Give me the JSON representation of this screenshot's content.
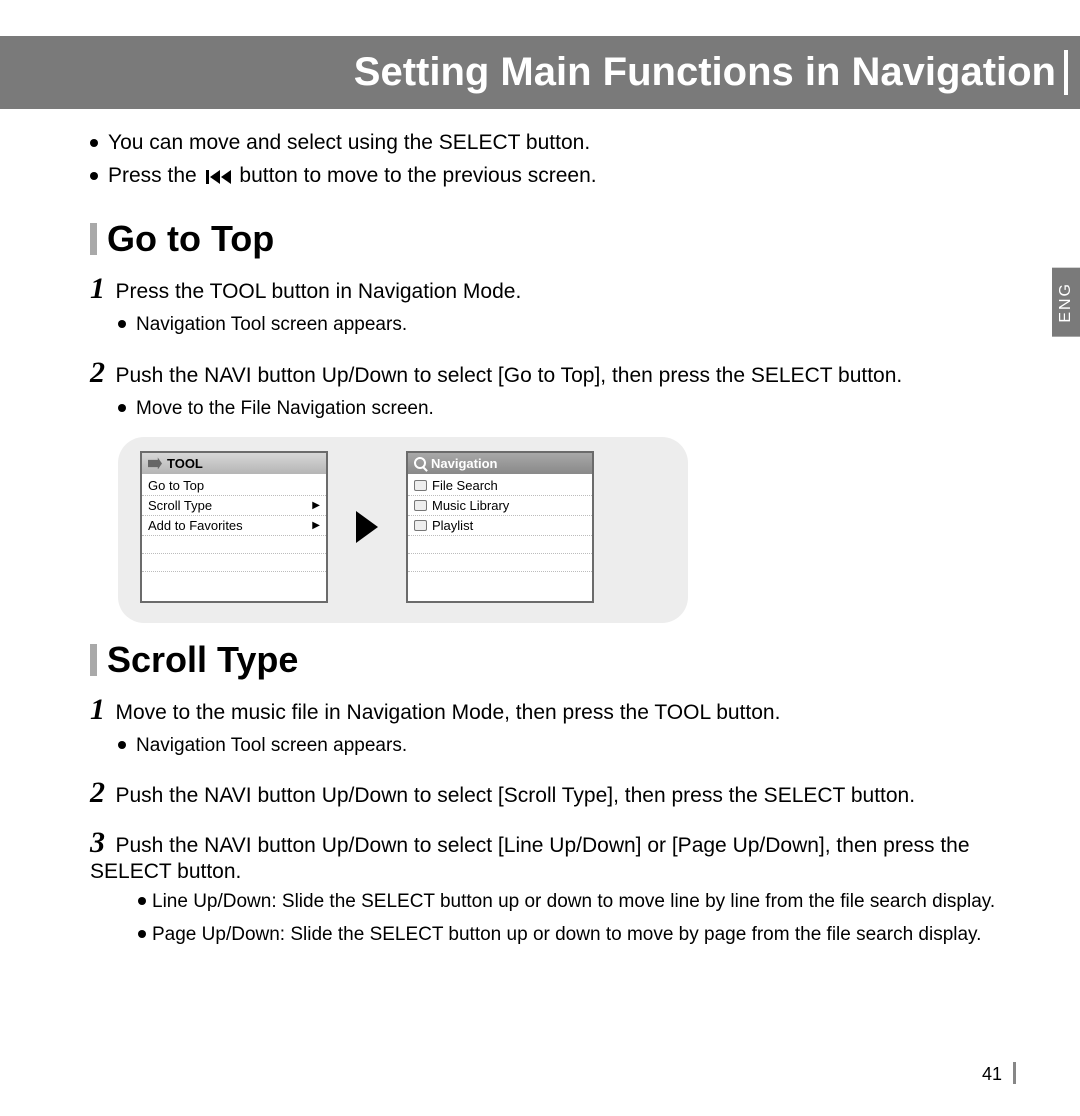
{
  "header": {
    "title": "Setting Main Functions in Navigation"
  },
  "lang_tab": "ENG",
  "intro": {
    "line1": "You can move and select using the SELECT button.",
    "line2a": "Press the",
    "line2b": "button to move to the previous screen."
  },
  "section1": {
    "title": "Go to Top",
    "step1": "Press the TOOL button in Navigation Mode.",
    "step1_sub": "Navigation Tool screen appears.",
    "step2": "Push the NAVI button Up/Down to select [Go to Top], then press the SELECT button.",
    "step2_sub": "Move to the File Navigation screen."
  },
  "screens": {
    "tool": {
      "title": "TOOL",
      "items": [
        "Go to Top",
        "Scroll Type",
        "Add to Favorites"
      ]
    },
    "nav": {
      "title": "Navigation",
      "items": [
        "File Search",
        "Music Library",
        "Playlist"
      ]
    }
  },
  "section2": {
    "title": "Scroll Type",
    "step1": "Move to the music file in Navigation Mode, then press the TOOL button.",
    "step1_sub": "Navigation Tool screen appears.",
    "step2": "Push the NAVI button Up/Down to select [Scroll Type], then press the SELECT button.",
    "step3": "Push the NAVI button Up/Down to select [Line Up/Down] or [Page Up/Down], then press the SELECT button.",
    "step3_sub1_label": "Line Up/Down:",
    "step3_sub1_text": "Slide the SELECT button up or down to move line by line from the file search display.",
    "step3_sub2_label": "Page Up/Down:",
    "step3_sub2_text": "Slide the SELECT button up or down to move by page from the file search display."
  },
  "page_number": "41"
}
